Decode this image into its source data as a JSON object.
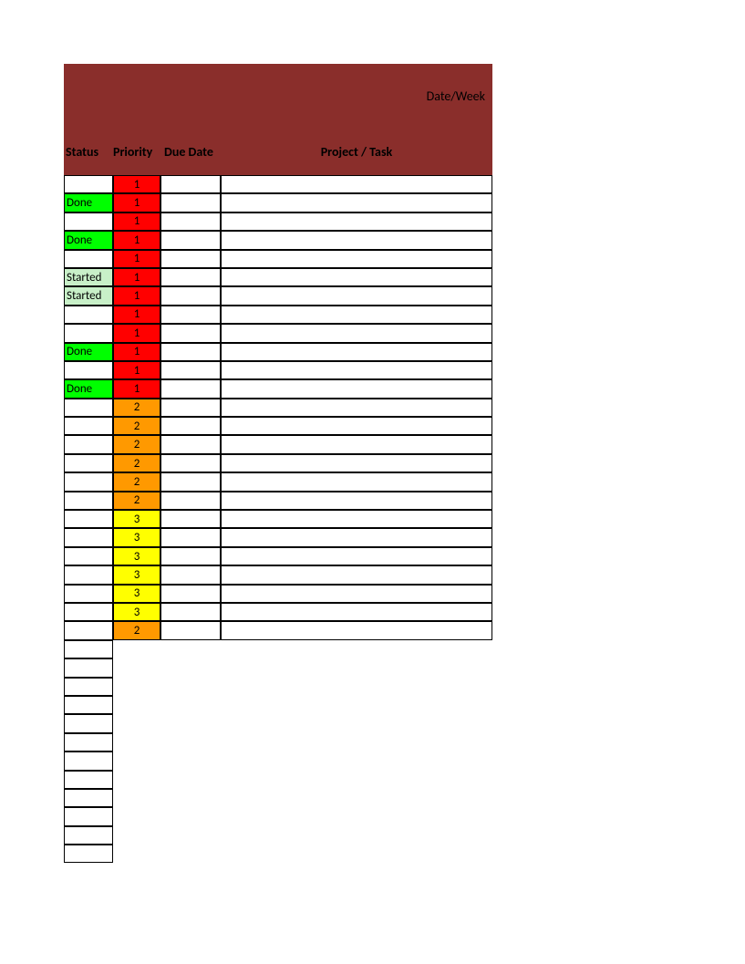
{
  "header": {
    "date_week_label": "Date/Week",
    "columns": {
      "status": "Status",
      "priority": "Priority",
      "due_date": "Due Date",
      "project_task": "Project / Task"
    }
  },
  "colors": {
    "header_bg": "#8a2e2b",
    "status_done": "#00ff00",
    "status_started": "#c8f0c8",
    "priority_1": "#ff0000",
    "priority_2": "#ff9900",
    "priority_3": "#ffff00"
  },
  "rows": [
    {
      "status": "",
      "status_class": "",
      "priority": "1",
      "priority_class": "priority-1",
      "due_date": "",
      "project_task": ""
    },
    {
      "status": "Done",
      "status_class": "status-done",
      "priority": "1",
      "priority_class": "priority-1",
      "due_date": "",
      "project_task": ""
    },
    {
      "status": "",
      "status_class": "",
      "priority": "1",
      "priority_class": "priority-1",
      "due_date": "",
      "project_task": ""
    },
    {
      "status": "Done",
      "status_class": "status-done",
      "priority": "1",
      "priority_class": "priority-1",
      "due_date": "",
      "project_task": ""
    },
    {
      "status": "",
      "status_class": "",
      "priority": "1",
      "priority_class": "priority-1",
      "due_date": "",
      "project_task": ""
    },
    {
      "status": "Started",
      "status_class": "status-started",
      "priority": "1",
      "priority_class": "priority-1",
      "due_date": "",
      "project_task": ""
    },
    {
      "status": "Started",
      "status_class": "status-started",
      "priority": "1",
      "priority_class": "priority-1",
      "due_date": "",
      "project_task": ""
    },
    {
      "status": "",
      "status_class": "",
      "priority": "1",
      "priority_class": "priority-1",
      "due_date": "",
      "project_task": ""
    },
    {
      "status": "",
      "status_class": "",
      "priority": "1",
      "priority_class": "priority-1",
      "due_date": "",
      "project_task": ""
    },
    {
      "status": "Done",
      "status_class": "status-done",
      "priority": "1",
      "priority_class": "priority-1",
      "due_date": "",
      "project_task": ""
    },
    {
      "status": "",
      "status_class": "",
      "priority": "1",
      "priority_class": "priority-1",
      "due_date": "",
      "project_task": ""
    },
    {
      "status": "Done",
      "status_class": "status-done",
      "priority": "1",
      "priority_class": "priority-1",
      "due_date": "",
      "project_task": ""
    },
    {
      "status": "",
      "status_class": "",
      "priority": "2",
      "priority_class": "priority-2",
      "due_date": "",
      "project_task": ""
    },
    {
      "status": "",
      "status_class": "",
      "priority": "2",
      "priority_class": "priority-2",
      "due_date": "",
      "project_task": ""
    },
    {
      "status": "",
      "status_class": "",
      "priority": "2",
      "priority_class": "priority-2",
      "due_date": "",
      "project_task": ""
    },
    {
      "status": "",
      "status_class": "",
      "priority": "2",
      "priority_class": "priority-2",
      "due_date": "",
      "project_task": ""
    },
    {
      "status": "",
      "status_class": "",
      "priority": "2",
      "priority_class": "priority-2",
      "due_date": "",
      "project_task": ""
    },
    {
      "status": "",
      "status_class": "",
      "priority": "2",
      "priority_class": "priority-2",
      "due_date": "",
      "project_task": ""
    },
    {
      "status": "",
      "status_class": "",
      "priority": "3",
      "priority_class": "priority-3",
      "due_date": "",
      "project_task": ""
    },
    {
      "status": "",
      "status_class": "",
      "priority": "3",
      "priority_class": "priority-3",
      "due_date": "",
      "project_task": ""
    },
    {
      "status": "",
      "status_class": "",
      "priority": "3",
      "priority_class": "priority-3",
      "due_date": "",
      "project_task": ""
    },
    {
      "status": "",
      "status_class": "",
      "priority": "3",
      "priority_class": "priority-3",
      "due_date": "",
      "project_task": ""
    },
    {
      "status": "",
      "status_class": "",
      "priority": "3",
      "priority_class": "priority-3",
      "due_date": "",
      "project_task": ""
    },
    {
      "status": "",
      "status_class": "",
      "priority": "3",
      "priority_class": "priority-3",
      "due_date": "",
      "project_task": ""
    },
    {
      "status": "",
      "status_class": "",
      "priority": "2",
      "priority_class": "priority-2",
      "due_date": "",
      "project_task": ""
    }
  ],
  "tail_row_count": 12
}
